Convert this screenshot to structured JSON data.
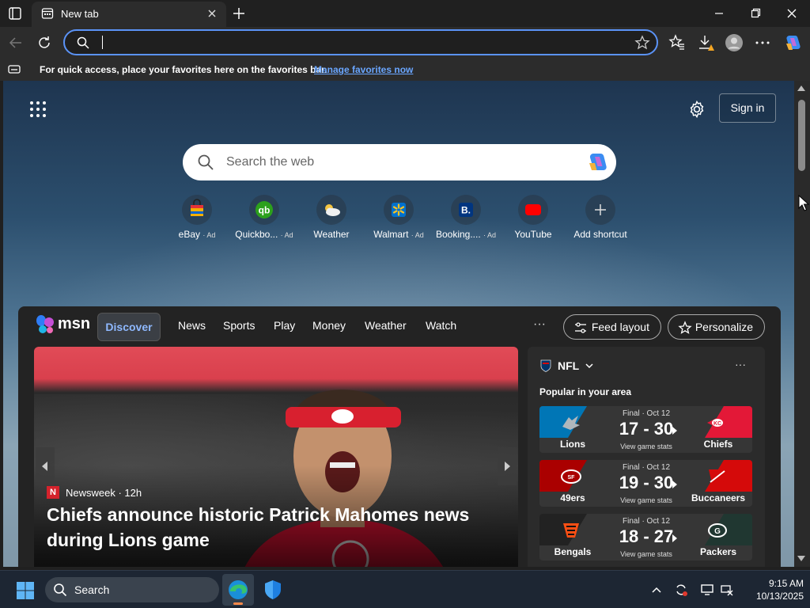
{
  "browser": {
    "tab_title": "New tab",
    "address_value": "",
    "favorites_bar_message": "For quick access, place your favorites here on the favorites bar.",
    "favorites_bar_link": "Manage favorites now"
  },
  "newtab": {
    "sign_in": "Sign in",
    "search_placeholder": "Search the web",
    "shortcuts": [
      {
        "label": "eBay",
        "ad": "· Ad"
      },
      {
        "label": "Quickbo...",
        "ad": "· Ad"
      },
      {
        "label": "Weather",
        "ad": ""
      },
      {
        "label": "Walmart",
        "ad": "· Ad"
      },
      {
        "label": "Booking....",
        "ad": "· Ad"
      },
      {
        "label": "YouTube",
        "ad": ""
      },
      {
        "label": "Add shortcut",
        "ad": ""
      }
    ]
  },
  "msn": {
    "logo_text": "msn",
    "tabs": [
      "Discover",
      "News",
      "Sports",
      "Play",
      "Money",
      "Weather",
      "Watch"
    ],
    "more": "···",
    "feed_layout": "Feed layout",
    "personalize": "Personalize",
    "hero": {
      "source": "Newsweek · 12h",
      "source_badge": "N",
      "headline": "Chiefs announce historic Patrick Mahomes news during Lions game"
    },
    "nfl": {
      "title": "NFL",
      "more": "···",
      "subtitle": "Popular in your area",
      "games": [
        {
          "status": "Final · Oct 12",
          "score": "17 - 30",
          "stats": "View game stats",
          "home": "Lions",
          "away": "Chiefs",
          "home_color": "#0076b6",
          "away_color": "#e31837"
        },
        {
          "status": "Final · Oct 12",
          "score": "19 - 30",
          "stats": "View game stats",
          "home": "49ers",
          "away": "Buccaneers",
          "home_color": "#aa0000",
          "away_color": "#d50a0a"
        },
        {
          "status": "Final · Oct 12",
          "score": "18 - 27",
          "stats": "View game stats",
          "home": "Bengals",
          "away": "Packers",
          "home_color": "#222222",
          "away_color": "#203731"
        }
      ]
    }
  },
  "taskbar": {
    "search_label": "Search",
    "time": "9:15 AM",
    "date": "10/13/2025"
  }
}
